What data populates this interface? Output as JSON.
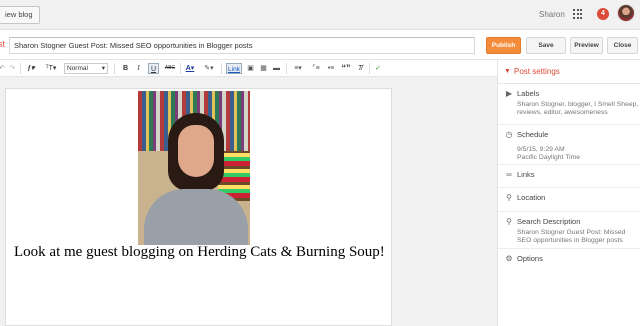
{
  "topbar": {
    "view_blog_label": "iew blog",
    "user_name": "Sharon",
    "notification_count": "4"
  },
  "post": {
    "label": "st",
    "title": "Sharon Stogner Guest Post: Missed SEO opportunities in Blogger posts"
  },
  "actions": {
    "publish": "Publish",
    "save": "Save",
    "preview": "Preview",
    "close": "Close"
  },
  "toolbar": {
    "font_icon": "𝓕",
    "size_icon": "ᵀT",
    "format_select": "Normal",
    "bold": "B",
    "italic": "I",
    "underline": "U",
    "strike": "ABC",
    "link": "Link",
    "quote": "“”",
    "clear": "T̸"
  },
  "editor": {
    "caption": "Look at me guest blogging on Herding Cats & Burning Soup!"
  },
  "sidebar": {
    "title": "Post settings",
    "sections": [
      {
        "name": "Labels",
        "value": "Sharon Stogner, blogger, I Smell Sheep, reviews, editor, awesomeness"
      },
      {
        "name": "Schedule",
        "value_line1": "9/5/15, 9:29 AM",
        "value_line2": "Pacific Daylight Time"
      },
      {
        "name": "Links"
      },
      {
        "name": "Location"
      },
      {
        "name": "Search Description",
        "value": "Sharon Stogner Guest Post: Missed SEO opportunities in Blogger posts"
      },
      {
        "name": "Options"
      }
    ]
  },
  "colors": {
    "accent": "#dd4b39",
    "publish": "#f48c3c"
  }
}
